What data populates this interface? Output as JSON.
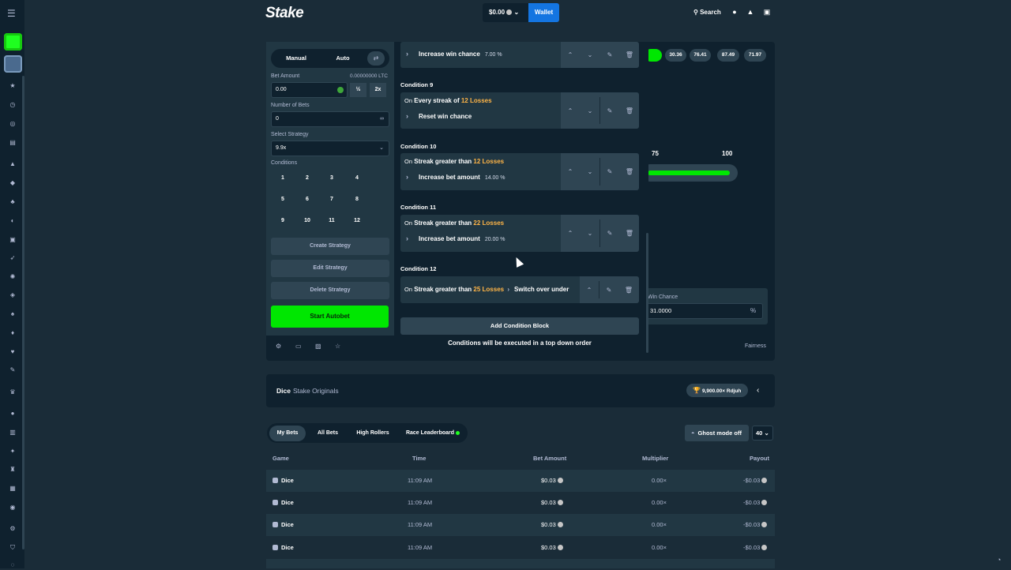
{
  "header": {
    "logo": "Stake",
    "balance": "$0.00",
    "wallet_label": "Wallet",
    "search_label": "Search"
  },
  "left_panel": {
    "tabs": [
      "Manual",
      "Auto"
    ],
    "bet_amount_label": "Bet Amount",
    "bet_amount_ltc": "0.00000000 LTC",
    "bet_amount_value": "0.00",
    "half_label": "½",
    "double_label": "2x",
    "number_of_bets_label": "Number of Bets",
    "number_of_bets_value": "0",
    "infinity_symbol": "∞",
    "select_strategy_label": "Select Strategy",
    "strategy_value": "9.9x",
    "conditions_label": "Conditions",
    "condition_numbers": [
      "1",
      "2",
      "3",
      "4",
      "5",
      "6",
      "7",
      "8",
      "9",
      "10",
      "11",
      "12"
    ],
    "create_strategy": "Create Strategy",
    "edit_strategy": "Edit Strategy",
    "delete_strategy": "Delete Strategy",
    "start_autobet": "Start Autobet",
    "fairness": "Fairness"
  },
  "game_area": {
    "history": [
      "30.36",
      "76.41",
      "87.49",
      "71.97"
    ],
    "slider_labels": [
      "75",
      "100"
    ],
    "win_chance_label": "Win Chance",
    "win_chance_value": "31.0000",
    "win_chance_unit": "%"
  },
  "conditions": {
    "partial_top_action": "Increase win chance",
    "partial_top_value": "7.00 %",
    "items": [
      {
        "title": "Condition 9",
        "on": "On",
        "trigger": "Every streak of",
        "highlight": "12 Losses",
        "action": "Reset win chance",
        "value": ""
      },
      {
        "title": "Condition 10",
        "on": "On",
        "trigger": "Streak greater than",
        "highlight": "12 Losses",
        "action": "Increase bet amount",
        "value": "14.00 %"
      },
      {
        "title": "Condition 11",
        "on": "On",
        "trigger": "Streak greater than",
        "highlight": "22 Losses",
        "action": "Increase bet amount",
        "value": "20.00 %"
      },
      {
        "title": "Condition 12",
        "on": "On",
        "trigger": "Streak greater than",
        "highlight": "25 Losses",
        "action": "Switch over under",
        "value": ""
      }
    ],
    "add_block": "Add Condition Block",
    "footnote": "Conditions will be executed in a top down order"
  },
  "info": {
    "title": "Dice",
    "subtitle": "Stake Originals",
    "badge": "9,900.00× Rdjuh"
  },
  "bets": {
    "tabs": [
      "My Bets",
      "All Bets",
      "High Rollers",
      "Race Leaderboard"
    ],
    "ghost_mode": "Ghost mode off",
    "count": "40",
    "columns": [
      "Game",
      "Time",
      "Bet Amount",
      "Multiplier",
      "Payout"
    ],
    "rows": [
      {
        "game": "Dice",
        "time": "11:09 AM",
        "bet": "$0.03",
        "multiplier": "0.00×",
        "payout": "-$0.03"
      },
      {
        "game": "Dice",
        "time": "11:09 AM",
        "bet": "$0.03",
        "multiplier": "0.00×",
        "payout": "-$0.03"
      },
      {
        "game": "Dice",
        "time": "11:09 AM",
        "bet": "$0.03",
        "multiplier": "0.00×",
        "payout": "-$0.03"
      },
      {
        "game": "Dice",
        "time": "11:09 AM",
        "bet": "$0.03",
        "multiplier": "0.00×",
        "payout": "-$0.03"
      }
    ]
  },
  "colors": {
    "accent_green": "#00e701",
    "wallet_blue": "#1475e1",
    "highlight_orange": "#ffb547"
  }
}
